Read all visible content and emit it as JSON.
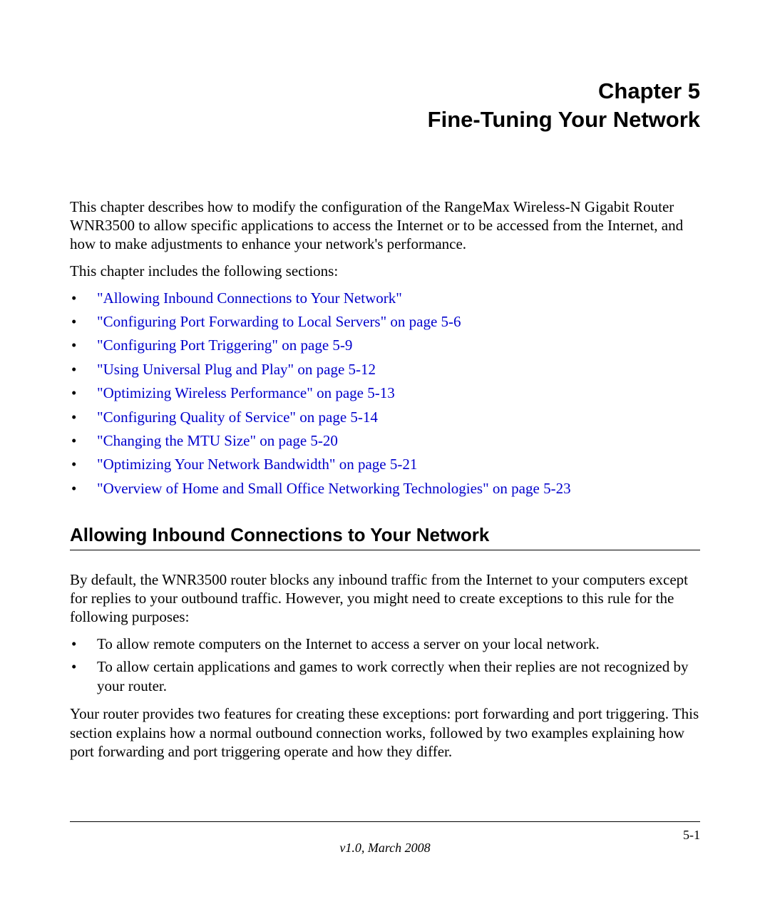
{
  "chapter": {
    "label": "Chapter 5",
    "title": "Fine-Tuning Your Network"
  },
  "intro": {
    "paragraph": "This chapter describes how to modify the configuration of the RangeMax Wireless-N Gigabit Router WNR3500 to allow specific applications to access the Internet or to be accessed from the Internet, and how to make adjustments to enhance your network's performance.",
    "followup": "This chapter includes the following sections:"
  },
  "toc": [
    "\"Allowing Inbound Connections to Your Network\"",
    "\"Configuring Port Forwarding to Local Servers\" on page 5-6",
    "\"Configuring Port Triggering\" on page 5-9",
    "\"Using Universal Plug and Play\" on page 5-12",
    "\"Optimizing Wireless Performance\" on page 5-13",
    "\"Configuring Quality of Service\" on page 5-14",
    "\"Changing the MTU Size\" on page 5-20",
    "\"Optimizing Your Network Bandwidth\" on page 5-21",
    "\"Overview of Home and Small Office Networking Technologies\" on page 5-23"
  ],
  "section": {
    "heading": "Allowing Inbound Connections to Your Network",
    "para1": "By default, the WNR3500 router blocks any inbound traffic from the Internet to your computers except for replies to your outbound traffic. However, you might need to create exceptions to this rule for the following purposes:",
    "purposes": [
      "To allow remote computers on the Internet to access a server on your local network.",
      "To allow certain applications and games to work correctly when their replies are not recognized by your router."
    ],
    "para2": "Your router provides two features for creating these exceptions: port forwarding and port triggering. This section explains how a normal outbound connection works, followed by two examples explaining how port forwarding and port triggering operate and how they differ."
  },
  "footer": {
    "page": "5-1",
    "version": "v1.0, March 2008"
  }
}
